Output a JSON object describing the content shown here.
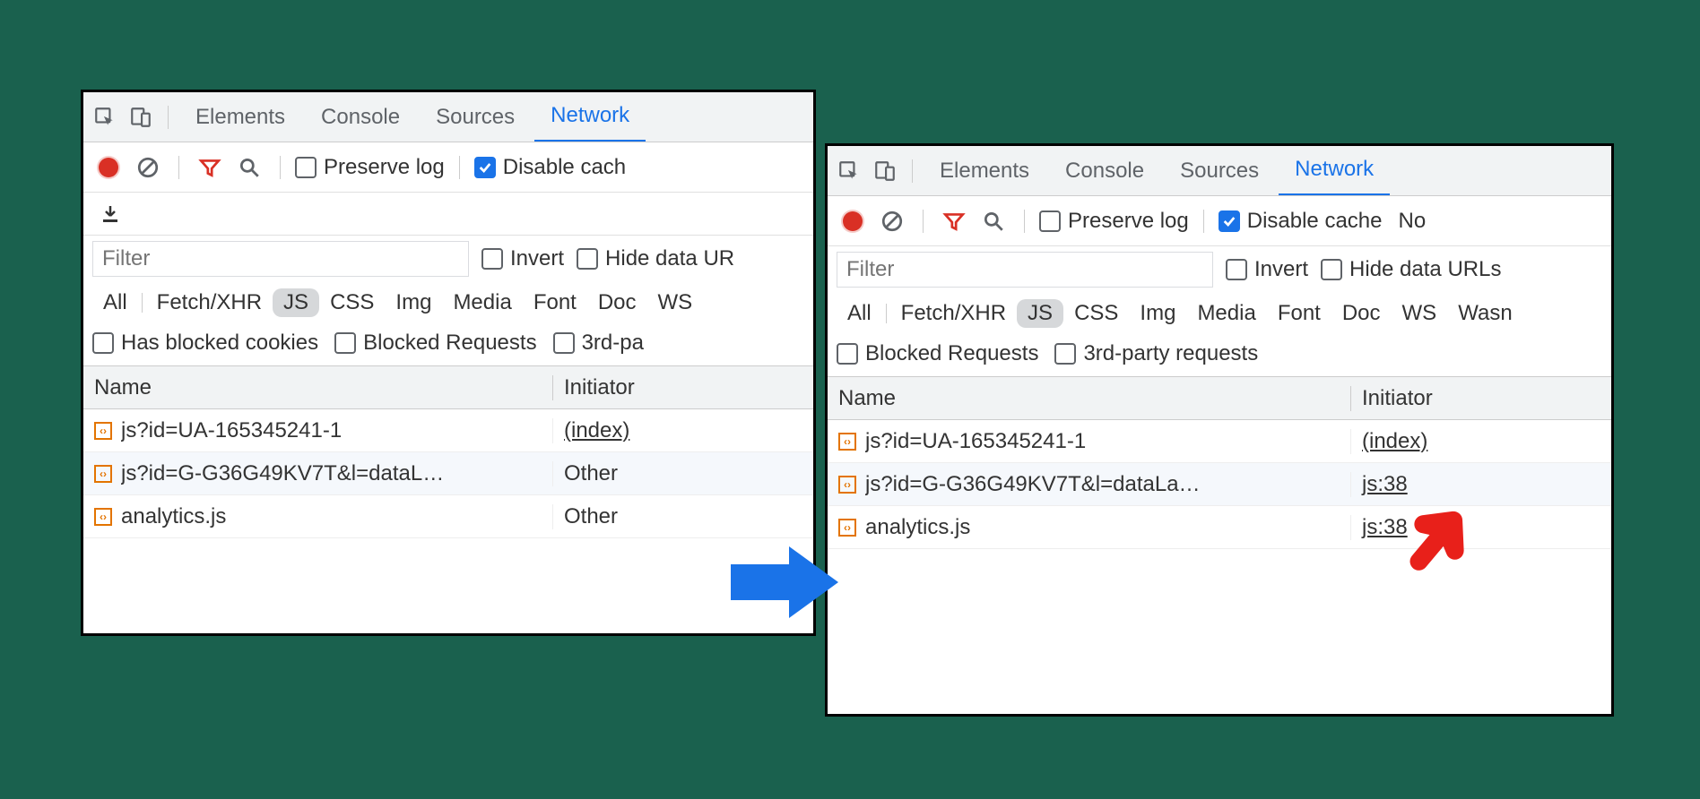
{
  "tabs": {
    "elements": "Elements",
    "console": "Console",
    "sources": "Sources",
    "network": "Network"
  },
  "toolbar": {
    "preserve_log": "Preserve log",
    "disable_cache_left": "Disable cach",
    "disable_cache_right": "Disable cache",
    "no_extra_right": "No"
  },
  "filter": {
    "placeholder": "Filter",
    "invert": "Invert",
    "hide_data_urls_left": "Hide data UR",
    "hide_data_urls_right": "Hide data URLs"
  },
  "types": {
    "all": "All",
    "fetch": "Fetch/XHR",
    "js": "JS",
    "css": "CSS",
    "img": "Img",
    "media": "Media",
    "font": "Font",
    "doc": "Doc",
    "ws": "WS",
    "wasm": "Wasn"
  },
  "options_left": {
    "has_blocked_cookies": "Has blocked cookies",
    "blocked_requests": "Blocked Requests",
    "third_party": "3rd-pa"
  },
  "options_right": {
    "blocked_requests": "Blocked Requests",
    "third_party": "3rd-party requests"
  },
  "columns": {
    "name": "Name",
    "initiator": "Initiator"
  },
  "rows_left": [
    {
      "name": "js?id=UA-165345241-1",
      "initiator": "(index)",
      "link": true
    },
    {
      "name": "js?id=G-G36G49KV7T&l=dataL…",
      "initiator": "Other",
      "link": false
    },
    {
      "name": "analytics.js",
      "initiator": "Other",
      "link": false
    }
  ],
  "rows_right": [
    {
      "name": "js?id=UA-165345241-1",
      "initiator": "(index)",
      "link": true
    },
    {
      "name": "js?id=G-G36G49KV7T&l=dataLa…",
      "initiator": "js:38",
      "link": true
    },
    {
      "name": "analytics.js",
      "initiator": "js:38",
      "link": true
    }
  ]
}
